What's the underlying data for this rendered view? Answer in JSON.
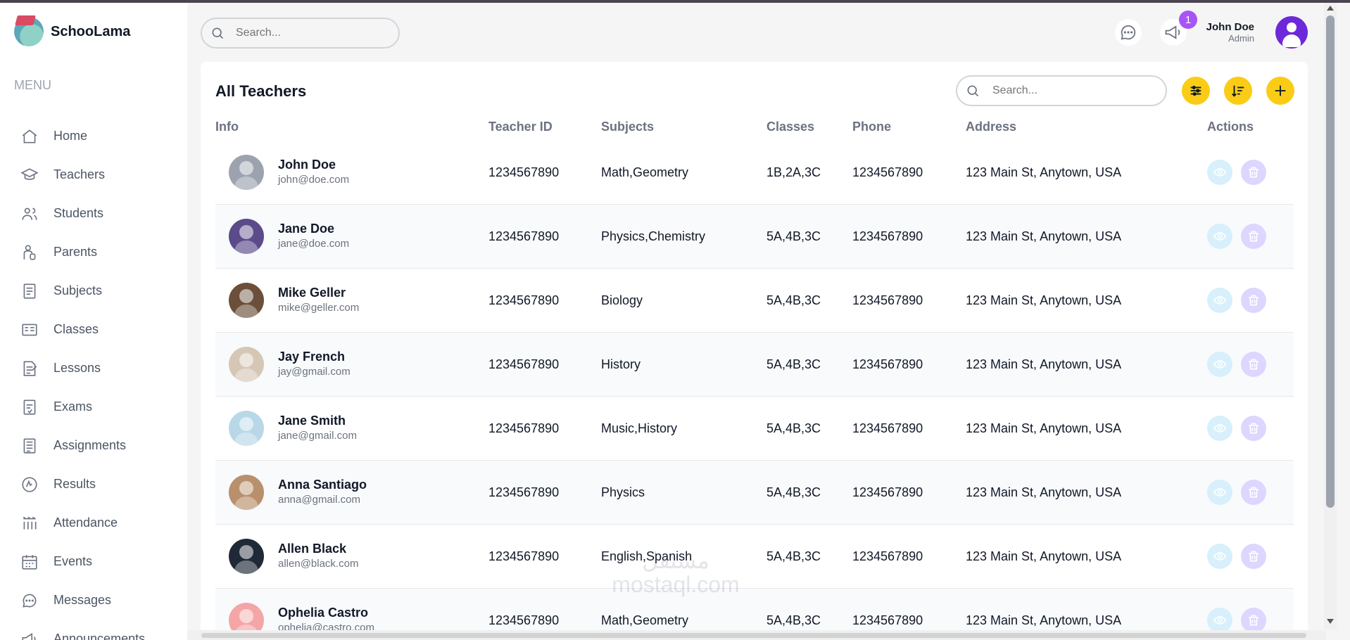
{
  "app": {
    "name": "SchooLama"
  },
  "sidebar": {
    "menu_title": "MENU",
    "items": [
      {
        "label": "Home",
        "icon": "home-icon"
      },
      {
        "label": "Teachers",
        "icon": "teacher-icon"
      },
      {
        "label": "Students",
        "icon": "students-icon"
      },
      {
        "label": "Parents",
        "icon": "parents-icon"
      },
      {
        "label": "Subjects",
        "icon": "subjects-icon"
      },
      {
        "label": "Classes",
        "icon": "classes-icon"
      },
      {
        "label": "Lessons",
        "icon": "lessons-icon"
      },
      {
        "label": "Exams",
        "icon": "exams-icon"
      },
      {
        "label": "Assignments",
        "icon": "assignments-icon"
      },
      {
        "label": "Results",
        "icon": "results-icon"
      },
      {
        "label": "Attendance",
        "icon": "attendance-icon"
      },
      {
        "label": "Events",
        "icon": "events-icon"
      },
      {
        "label": "Messages",
        "icon": "messages-icon"
      },
      {
        "label": "Announcements",
        "icon": "announcements-icon"
      }
    ]
  },
  "topbar": {
    "search_placeholder": "Search...",
    "notification_count": "1",
    "user": {
      "name": "John Doe",
      "role": "Admin"
    }
  },
  "teachers": {
    "title": "All Teachers",
    "search_placeholder": "Search...",
    "headers": [
      "Info",
      "Teacher ID",
      "Subjects",
      "Classes",
      "Phone",
      "Address",
      "Actions"
    ],
    "rows": [
      {
        "name": "John Doe",
        "email": "john@doe.com",
        "teacher_id": "1234567890",
        "subjects": "Math,Geometry",
        "classes": "1B,2A,3C",
        "phone": "1234567890",
        "address": "123 Main St, Anytown, USA",
        "photo_color": "#9ca3af"
      },
      {
        "name": "Jane Doe",
        "email": "jane@doe.com",
        "teacher_id": "1234567890",
        "subjects": "Physics,Chemistry",
        "classes": "5A,4B,3C",
        "phone": "1234567890",
        "address": "123 Main St, Anytown, USA",
        "photo_color": "#5b4b8a"
      },
      {
        "name": "Mike Geller",
        "email": "mike@geller.com",
        "teacher_id": "1234567890",
        "subjects": "Biology",
        "classes": "5A,4B,3C",
        "phone": "1234567890",
        "address": "123 Main St, Anytown, USA",
        "photo_color": "#6b4f3a"
      },
      {
        "name": "Jay French",
        "email": "jay@gmail.com",
        "teacher_id": "1234567890",
        "subjects": "History",
        "classes": "5A,4B,3C",
        "phone": "1234567890",
        "address": "123 Main St, Anytown, USA",
        "photo_color": "#d6c7b5"
      },
      {
        "name": "Jane Smith",
        "email": "jane@gmail.com",
        "teacher_id": "1234567890",
        "subjects": "Music,History",
        "classes": "5A,4B,3C",
        "phone": "1234567890",
        "address": "123 Main St, Anytown, USA",
        "photo_color": "#b8d8e8"
      },
      {
        "name": "Anna Santiago",
        "email": "anna@gmail.com",
        "teacher_id": "1234567890",
        "subjects": "Physics",
        "classes": "5A,4B,3C",
        "phone": "1234567890",
        "address": "123 Main St, Anytown, USA",
        "photo_color": "#b8906b"
      },
      {
        "name": "Allen Black",
        "email": "allen@black.com",
        "teacher_id": "1234567890",
        "subjects": "English,Spanish",
        "classes": "5A,4B,3C",
        "phone": "1234567890",
        "address": "123 Main St, Anytown, USA",
        "photo_color": "#1f2937"
      },
      {
        "name": "Ophelia Castro",
        "email": "ophelia@castro.com",
        "teacher_id": "1234567890",
        "subjects": "Math,Geometry",
        "classes": "5A,4B,3C",
        "phone": "1234567890",
        "address": "123 Main St, Anytown, USA",
        "photo_color": "#f4a6a6"
      }
    ]
  },
  "watermark": {
    "line1": "مستقل",
    "line2": "mostaql.com"
  },
  "colors": {
    "accent": "#facc15",
    "badge": "#a855f7",
    "view_button": "#d7f0fb",
    "delete_button": "#ddd6fe"
  }
}
